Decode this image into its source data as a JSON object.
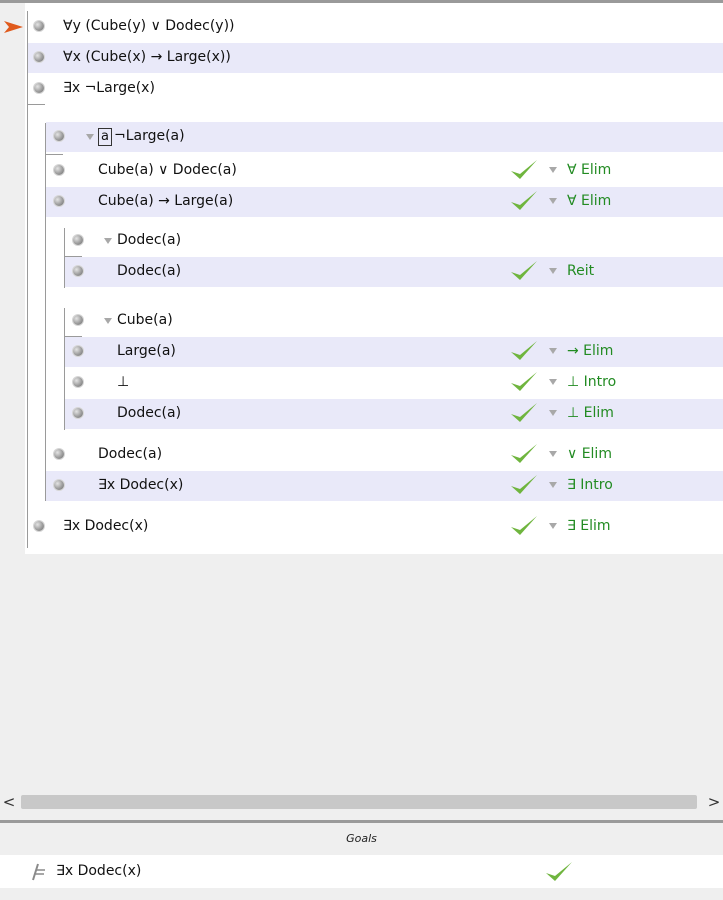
{
  "proof": {
    "premises": [
      {
        "text": "∀y (Cube(y) ∨ Dodec(y))"
      },
      {
        "text": "∀x (Cube(x) → Large(x))"
      },
      {
        "text": "∃x ¬Large(x)"
      }
    ],
    "subproof_a": {
      "boxed_var": "a",
      "assumption": "¬Large(a)",
      "steps": [
        {
          "text": "Cube(a) ∨ Dodec(a)",
          "rule": "∀ Elim"
        },
        {
          "text": "Cube(a)  →  Large(a)",
          "rule": "∀ Elim"
        }
      ]
    },
    "case_dodec": {
      "assumption": "Dodec(a)",
      "steps": [
        {
          "text": "Dodec(a)",
          "rule": "Reit"
        }
      ]
    },
    "case_cube": {
      "assumption": "Cube(a)",
      "steps": [
        {
          "text": "Large(a)",
          "rule": "→ Elim"
        },
        {
          "text": "⊥",
          "rule": "⊥ Intro"
        },
        {
          "text": "Dodec(a)",
          "rule": "⊥ Elim"
        }
      ]
    },
    "subproof_a_end": [
      {
        "text": "Dodec(a)",
        "rule": "∨ Elim"
      },
      {
        "text": "∃x Dodec(x)",
        "rule": "∃ Intro"
      }
    ],
    "conclusion": {
      "text": "∃x Dodec(x)",
      "rule": "∃ Elim"
    }
  },
  "scrollbar": {
    "left_arrow": "<",
    "right_arrow": ">"
  },
  "goals": {
    "title": "Goals",
    "items": [
      {
        "text": "∃x Dodec(x)"
      }
    ]
  },
  "colors": {
    "rule_text": "#228b22",
    "check": "#6fb53e",
    "focus_arrow": "#e05a1c",
    "alt_row": "#e9e9f9"
  }
}
